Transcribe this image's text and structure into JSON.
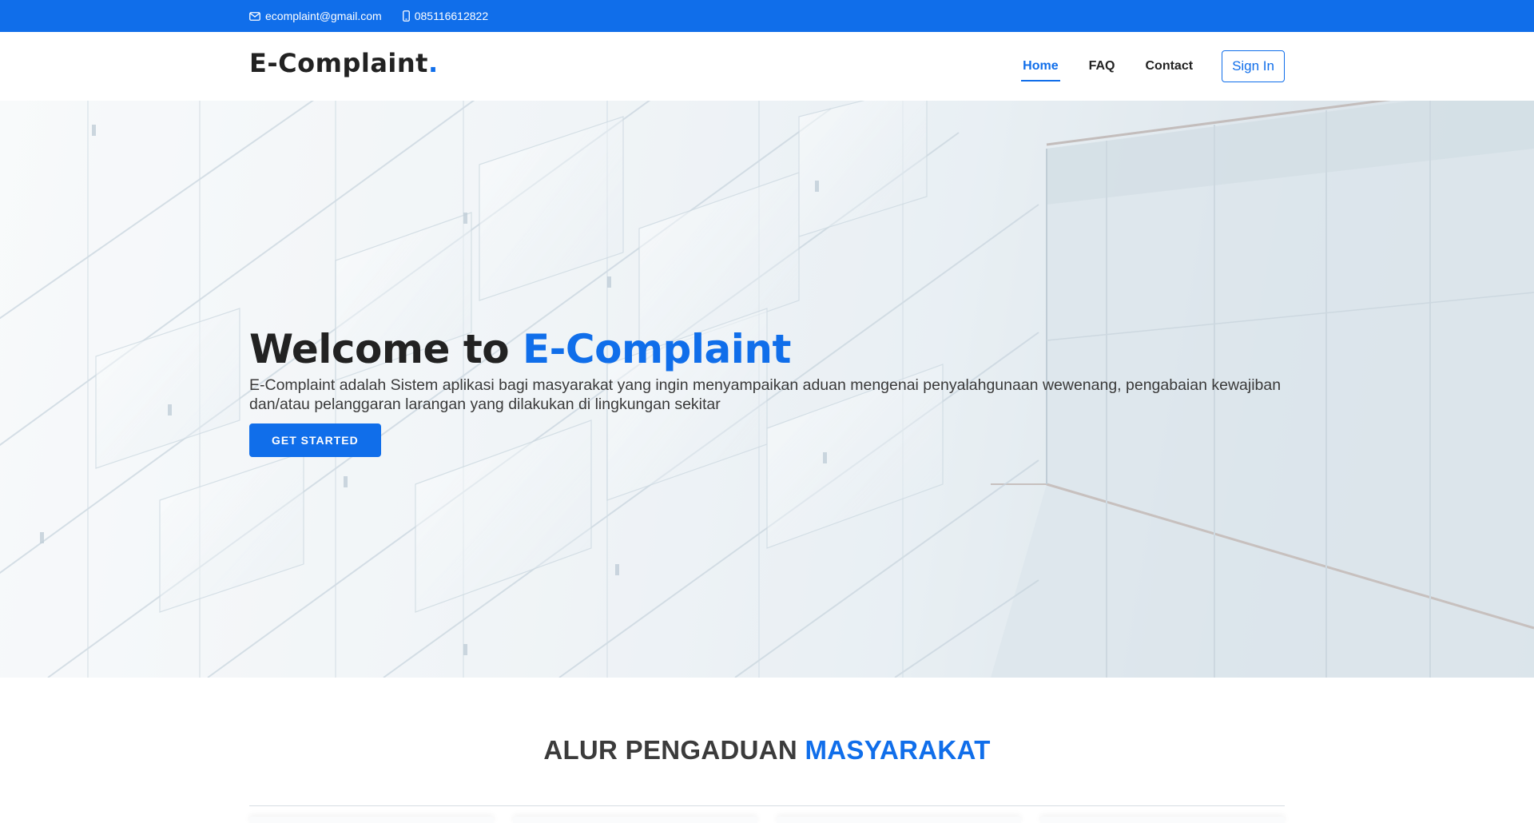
{
  "topbar": {
    "email": "ecomplaint@gmail.com",
    "phone": "085116612822",
    "email_icon": "envelope-icon",
    "phone_icon": "phone-icon"
  },
  "header": {
    "logo_text": "E-Complaint",
    "logo_dot": ".",
    "nav": [
      {
        "label": "Home",
        "active": true
      },
      {
        "label": "FAQ",
        "active": false
      },
      {
        "label": "Contact",
        "active": false
      }
    ],
    "signin_label": "Sign In"
  },
  "hero": {
    "title_prefix": "Welcome to",
    "title_accent": "E-Complaint",
    "description": "E-Complaint adalah Sistem aplikasi bagi masyarakat yang ingin menyampaikan aduan mengenai penyalahgunaan wewenang, pengabaian kewajiban dan/atau pelanggaran larangan yang dilakukan di lingkungan sekitar",
    "cta_label": "GET STARTED"
  },
  "section": {
    "title_prefix": "ALUR PENGADUAN",
    "title_accent": "MASYARAKAT"
  },
  "colors": {
    "primary": "#106eea",
    "text_dark": "#222222"
  }
}
